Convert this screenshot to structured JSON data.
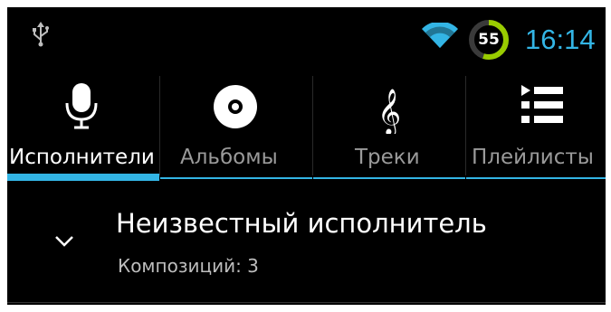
{
  "status_bar": {
    "icons": [
      "usb-icon",
      "wifi-icon"
    ],
    "battery_level": "55",
    "battery_fraction": 0.55,
    "clock": "16:14"
  },
  "colors": {
    "accent": "#33b5e5",
    "battery_ring": "#99cc00",
    "background": "#000000",
    "active_label": "#ffffff",
    "inactive_label": "#9a9a9a"
  },
  "tabs": [
    {
      "label": "Исполнители",
      "icon": "microphone-icon",
      "active": true
    },
    {
      "label": "Альбомы",
      "icon": "disc-icon",
      "active": false
    },
    {
      "label": "Треки",
      "icon": "treble-clef-icon",
      "active": false
    },
    {
      "label": "Плейлисты",
      "icon": "playlist-icon",
      "active": false
    }
  ],
  "list": {
    "items": [
      {
        "title": "Неизвестный исполнитель",
        "subtitle": "Композиций: 3",
        "icon": "chevron-down-icon"
      }
    ]
  }
}
